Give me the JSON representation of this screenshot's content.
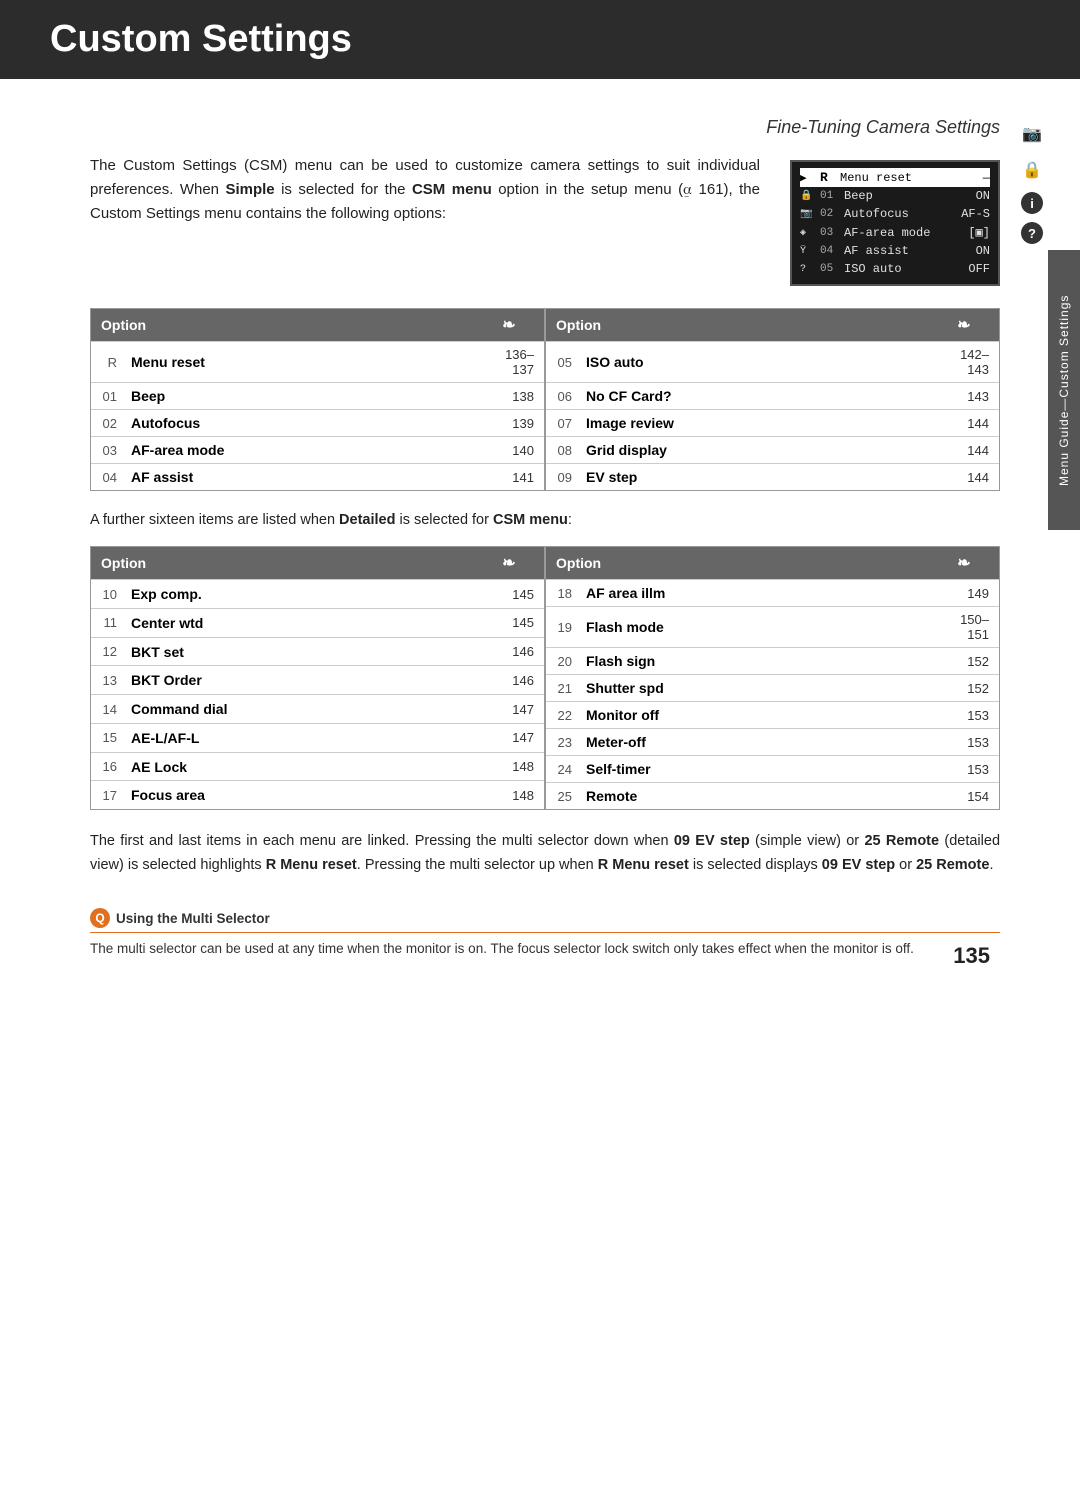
{
  "header": {
    "title": "Custom Settings",
    "subtitle": "Fine-Tuning Camera Settings",
    "background_color": "#2c2c2c"
  },
  "intro": {
    "text_parts": [
      "The Custom Settings (CSM) menu can be used to customize camera settings to suit individual preferences.  When ",
      "Simple",
      " is selected for the ",
      "CSM menu",
      " option in the setup menu (",
      "161",
      "), the Custom Settings menu contains the following options:"
    ],
    "full_text": "The Custom Settings (CSM) menu can be used to customize camera settings to suit individual preferences. When Simple is selected for the CSM menu option in the setup menu (161), the Custom Settings menu contains the following options:"
  },
  "camera_screen": {
    "rows": [
      {
        "icon": "▶",
        "num": "",
        "label": "Menu reset",
        "value": "—",
        "highlighted": true
      },
      {
        "icon": "🔒",
        "num": "01",
        "label": "Beep",
        "value": "ON",
        "highlighted": false
      },
      {
        "icon": "📷",
        "num": "02",
        "label": "Autofocus",
        "value": "AF-S",
        "highlighted": false
      },
      {
        "icon": "◈",
        "num": "03",
        "label": "AF-area mode",
        "value": "[◻]",
        "highlighted": false
      },
      {
        "icon": "Ÿ",
        "num": "04",
        "label": "AF assist",
        "value": "ON",
        "highlighted": false
      },
      {
        "icon": "?",
        "num": "05",
        "label": "ISO auto",
        "value": "OFF",
        "highlighted": false
      }
    ]
  },
  "simple_table": {
    "intro_label": "Option",
    "icon_label": "❧",
    "left": {
      "header": {
        "num": "",
        "label": "Option",
        "page": "❧"
      },
      "rows": [
        {
          "num": "R",
          "label": "Menu reset",
          "page": "136–137"
        },
        {
          "num": "01",
          "label": "Beep",
          "page": "138"
        },
        {
          "num": "02",
          "label": "Autofocus",
          "page": "139"
        },
        {
          "num": "03",
          "label": "AF-area mode",
          "page": "140"
        },
        {
          "num": "04",
          "label": "AF assist",
          "page": "141"
        }
      ]
    },
    "right": {
      "header": {
        "num": "",
        "label": "Option",
        "page": "❧"
      },
      "rows": [
        {
          "num": "05",
          "label": "ISO auto",
          "page": "142–143"
        },
        {
          "num": "06",
          "label": "No CF Card?",
          "page": "143"
        },
        {
          "num": "07",
          "label": "Image review",
          "page": "144"
        },
        {
          "num": "08",
          "label": "Grid display",
          "page": "144"
        },
        {
          "num": "09",
          "label": "EV step",
          "page": "144"
        }
      ]
    }
  },
  "between_text": "A further sixteen items are listed when Detailed is selected for CSM menu:",
  "detailed_table": {
    "left": {
      "rows": [
        {
          "num": "10",
          "label": "Exp comp.",
          "page": "145"
        },
        {
          "num": "11",
          "label": "Center wtd",
          "page": "145"
        },
        {
          "num": "12",
          "label": "BKT set",
          "page": "146"
        },
        {
          "num": "13",
          "label": "BKT Order",
          "page": "146"
        },
        {
          "num": "14",
          "label": "Command dial",
          "page": "147"
        },
        {
          "num": "15",
          "label": "AE-L/AF-L",
          "page": "147"
        },
        {
          "num": "16",
          "label": "AE Lock",
          "page": "148"
        },
        {
          "num": "17",
          "label": "Focus area",
          "page": "148"
        }
      ]
    },
    "right": {
      "rows": [
        {
          "num": "18",
          "label": "AF area illm",
          "page": "149"
        },
        {
          "num": "19",
          "label": "Flash mode",
          "page": "150–151"
        },
        {
          "num": "20",
          "label": "Flash sign",
          "page": "152"
        },
        {
          "num": "21",
          "label": "Shutter spd",
          "page": "152"
        },
        {
          "num": "22",
          "label": "Monitor off",
          "page": "153"
        },
        {
          "num": "23",
          "label": "Meter-off",
          "page": "153"
        },
        {
          "num": "24",
          "label": "Self-timer",
          "page": "153"
        },
        {
          "num": "25",
          "label": "Remote",
          "page": "154"
        }
      ]
    }
  },
  "bottom_text": "The first and last items in each menu are linked.  Pressing the multi selector down when 09 EV step (simple view) or 25 Remote (detailed view) is selected highlights R Menu reset.  Pressing the multi selector up when R Menu reset is selected displays 09 EV step or 25 Remote.",
  "note": {
    "title": "Using the Multi Selector",
    "text": "The multi selector can be used at any time when the monitor is on.  The focus selector lock switch only takes effect when the monitor is off."
  },
  "page_number": "135",
  "side_tab_label": "Menu Guide—Custom Settings"
}
